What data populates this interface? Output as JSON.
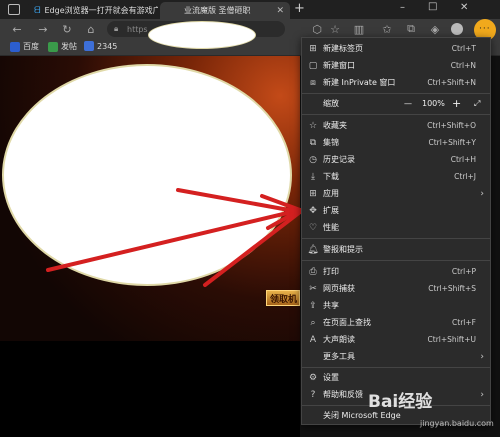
{
  "tabs": [
    {
      "title": "Edge浏览器一打开就会有游戏广",
      "active": false
    },
    {
      "title": "业流魔版 圣僧砸职",
      "active": true
    }
  ],
  "new_tab_label": "+",
  "window_controls": {
    "minimize": "–",
    "maximize": "□",
    "close": "✕"
  },
  "address": {
    "text": "https"
  },
  "favorites": [
    {
      "label": "百度",
      "color": "#2c5ecf"
    },
    {
      "label": "发帖",
      "color": "#3a9a4a"
    },
    {
      "label": "2345",
      "color": "#3d6fd8"
    }
  ],
  "game": {
    "button_label": "领取机"
  },
  "menu": {
    "items": [
      {
        "label": "新建标签页",
        "shortcut": "Ctrl+T",
        "icon": "new-tab-icon"
      },
      {
        "label": "新建窗口",
        "shortcut": "Ctrl+N",
        "icon": "new-window-icon"
      },
      {
        "label": "新建 InPrivate 窗口",
        "shortcut": "Ctrl+Shift+N",
        "icon": "inprivate-icon"
      }
    ],
    "zoom": {
      "label": "缩放",
      "minus": "—",
      "value": "100%",
      "plus": "+",
      "fullscreen": "⤢"
    },
    "items2": [
      {
        "label": "收藏夹",
        "shortcut": "Ctrl+Shift+O",
        "icon": "favorites-icon"
      },
      {
        "label": "集锦",
        "shortcut": "Ctrl+Shift+Y",
        "icon": "collections-icon"
      },
      {
        "label": "历史记录",
        "shortcut": "Ctrl+H",
        "icon": "history-icon"
      },
      {
        "label": "下载",
        "shortcut": "Ctrl+J",
        "icon": "download-icon"
      },
      {
        "label": "应用",
        "shortcut": "",
        "icon": "apps-icon",
        "arrow": true
      },
      {
        "label": "扩展",
        "shortcut": "",
        "icon": "extensions-icon"
      },
      {
        "label": "性能",
        "shortcut": "",
        "icon": "performance-icon"
      }
    ],
    "items3": [
      {
        "label": "警报和提示",
        "shortcut": "",
        "icon": "bell-icon"
      }
    ],
    "items4": [
      {
        "label": "打印",
        "shortcut": "Ctrl+P",
        "icon": "print-icon"
      },
      {
        "label": "网页捕获",
        "shortcut": "Ctrl+Shift+S",
        "icon": "capture-icon"
      },
      {
        "label": "共享",
        "shortcut": "",
        "icon": "share-icon"
      },
      {
        "label": "在页面上查找",
        "shortcut": "Ctrl+F",
        "icon": "find-icon"
      },
      {
        "label": "大声朗读",
        "shortcut": "Ctrl+Shift+U",
        "icon": "read-aloud-icon"
      },
      {
        "label": "更多工具",
        "shortcut": "",
        "icon": "",
        "arrow": true
      }
    ],
    "items5": [
      {
        "label": "设置",
        "shortcut": "",
        "icon": "settings-icon"
      },
      {
        "label": "帮助和反馈",
        "shortcut": "",
        "icon": "help-icon",
        "arrow": true
      }
    ],
    "close_label": "关闭 Microsoft Edge"
  },
  "watermark": {
    "brand": "Bai经验",
    "url": "jingyan.baidu.com"
  },
  "colors": {
    "menu_bg": "#2b2b2b",
    "toolbar_bg": "#3a3a3a",
    "arrow_red": "#d42020",
    "highlight": "#f1a91c"
  }
}
